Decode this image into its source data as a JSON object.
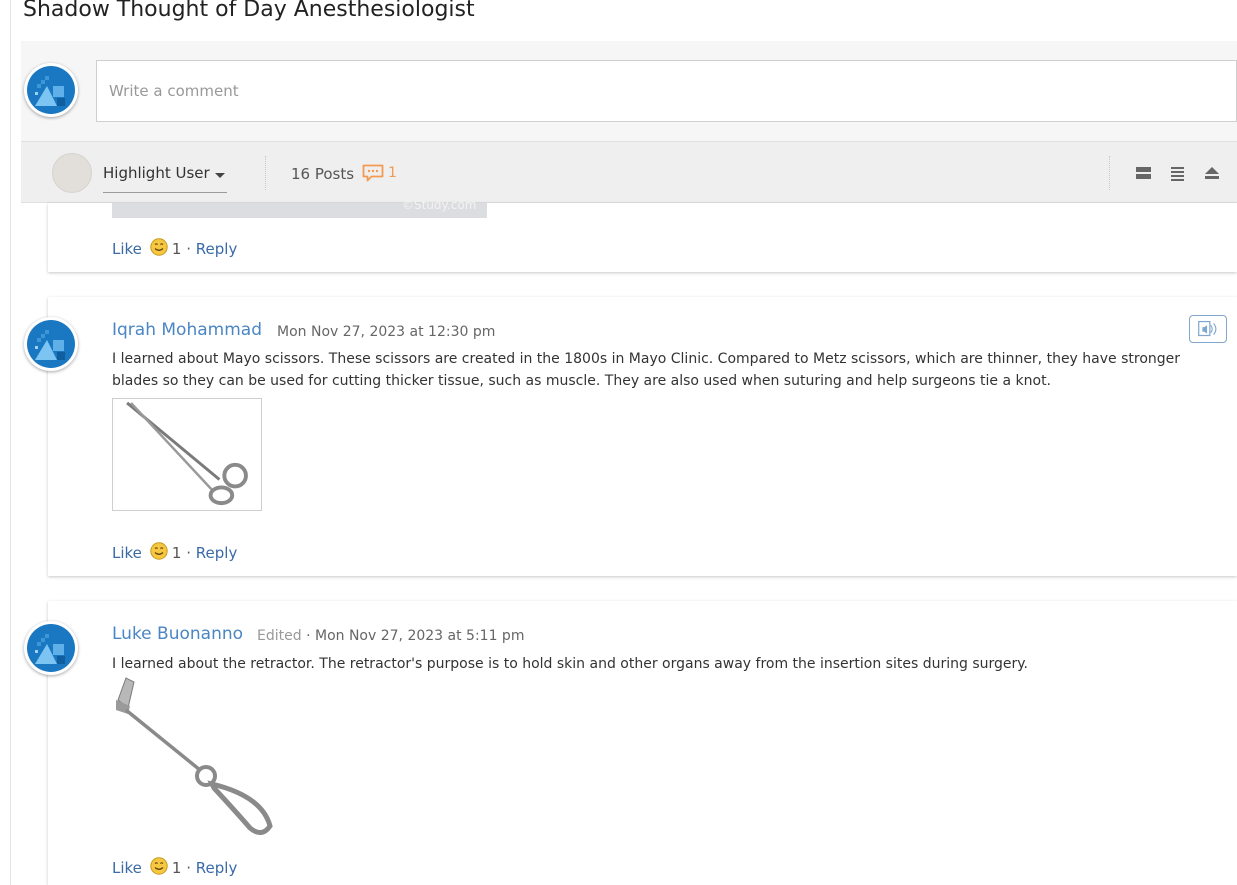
{
  "page": {
    "title": "Shadow Thought of Day Anesthesiologist"
  },
  "composer": {
    "placeholder": "Write a comment"
  },
  "toolbar": {
    "highlight_label": "Highlight User",
    "posts_label": "16 Posts",
    "unread_count": "1",
    "view_icons": [
      "expanded-view-icon",
      "list-view-icon",
      "collapse-all-icon"
    ]
  },
  "colors": {
    "accent": "#4a86c4",
    "unread": "#f29a51",
    "avatar_blue": "#1a78c2"
  },
  "posts": [
    {
      "like_label": "Like",
      "like_count": "1",
      "separator": "·",
      "reply_label": "Reply",
      "watermark": "©Study.com"
    },
    {
      "author": "Iqrah Mohammad",
      "timestamp": "Mon Nov 27, 2023 at 12:30 pm",
      "body": "I learned about Mayo scissors. These scissors are created in the 1800s in Mayo Clinic. Compared to Metz scissors, which are thinner, they have stronger blades so they can be used for cutting thicker tissue, such as muscle. They are also used when suturing and help surgeons tie a knot.",
      "attachment_icon": "scissors-image",
      "like_label": "Like",
      "like_count": "1",
      "separator": "·",
      "reply_label": "Reply"
    },
    {
      "author": "Luke Buonanno",
      "edited_label": "Edited",
      "meta_separator": "·",
      "timestamp": "Mon Nov 27, 2023 at 5:11 pm",
      "body": "I learned about the retractor. The retractor's purpose is to hold skin and other organs away from the insertion sites during surgery.",
      "attachment_icon": "retractor-image",
      "like_label": "Like",
      "like_count": "1",
      "separator": "·",
      "reply_label": "Reply"
    }
  ]
}
